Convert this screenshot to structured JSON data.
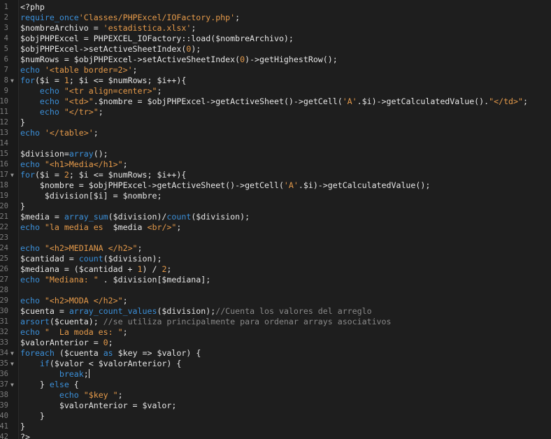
{
  "editor": {
    "lines": [
      {
        "num": "1",
        "fold": "",
        "tokens": [
          {
            "t": "def",
            "v": "<?php"
          }
        ]
      },
      {
        "num": "2",
        "fold": "",
        "tokens": [
          {
            "t": "kw",
            "v": "require_once"
          },
          {
            "t": "str",
            "v": "'Classes/PHPExcel/IOFactory.php'"
          },
          {
            "t": "def",
            "v": ";"
          }
        ]
      },
      {
        "num": "3",
        "fold": "",
        "tokens": [
          {
            "t": "var",
            "v": "$nombreArchivo = "
          },
          {
            "t": "str",
            "v": "'estadistica.xlsx'"
          },
          {
            "t": "def",
            "v": ";"
          }
        ]
      },
      {
        "num": "4",
        "fold": "",
        "tokens": [
          {
            "t": "var",
            "v": "$objPHPExcel = PHPEXCEL_IOFactory::load($nombreArchivo);"
          }
        ]
      },
      {
        "num": "5",
        "fold": "",
        "tokens": [
          {
            "t": "var",
            "v": "$objPHPExcel->setActiveSheetIndex("
          },
          {
            "t": "num",
            "v": "0"
          },
          {
            "t": "def",
            "v": ");"
          }
        ]
      },
      {
        "num": "6",
        "fold": "",
        "tokens": [
          {
            "t": "var",
            "v": "$numRows = $objPHPExcel->setActiveSheetIndex("
          },
          {
            "t": "num",
            "v": "0"
          },
          {
            "t": "def",
            "v": ")->getHighestRow();"
          }
        ]
      },
      {
        "num": "7",
        "fold": "",
        "tokens": [
          {
            "t": "kw",
            "v": "echo "
          },
          {
            "t": "str",
            "v": "'<table border=2>'"
          },
          {
            "t": "def",
            "v": ";"
          }
        ]
      },
      {
        "num": "8",
        "fold": "▼",
        "tokens": [
          {
            "t": "kw",
            "v": "for"
          },
          {
            "t": "def",
            "v": "($i = "
          },
          {
            "t": "num",
            "v": "1"
          },
          {
            "t": "def",
            "v": "; $i <= $numRows; $i++){"
          }
        ]
      },
      {
        "num": "9",
        "fold": "",
        "tokens": [
          {
            "t": "def",
            "v": "    "
          },
          {
            "t": "kw",
            "v": "echo "
          },
          {
            "t": "str",
            "v": "\"<tr align=center>\""
          },
          {
            "t": "def",
            "v": ";"
          }
        ]
      },
      {
        "num": "10",
        "fold": "",
        "tokens": [
          {
            "t": "def",
            "v": "    "
          },
          {
            "t": "kw",
            "v": "echo "
          },
          {
            "t": "str",
            "v": "\"<td>\""
          },
          {
            "t": "def",
            "v": ".$nombre = $objPHPExcel->getActiveSheet()->getCell("
          },
          {
            "t": "str",
            "v": "'A'"
          },
          {
            "t": "def",
            "v": ".$i)->getCalculatedValue()."
          },
          {
            "t": "str",
            "v": "\"</td>\""
          },
          {
            "t": "def",
            "v": ";"
          }
        ]
      },
      {
        "num": "11",
        "fold": "",
        "tokens": [
          {
            "t": "def",
            "v": "    "
          },
          {
            "t": "kw",
            "v": "echo "
          },
          {
            "t": "str",
            "v": "\"</tr>\""
          },
          {
            "t": "def",
            "v": ";"
          }
        ]
      },
      {
        "num": "12",
        "fold": "",
        "tokens": [
          {
            "t": "def",
            "v": "}"
          }
        ]
      },
      {
        "num": "13",
        "fold": "",
        "tokens": [
          {
            "t": "kw",
            "v": "echo "
          },
          {
            "t": "str",
            "v": "'</table>'"
          },
          {
            "t": "def",
            "v": ";"
          }
        ]
      },
      {
        "num": "14",
        "fold": "",
        "tokens": []
      },
      {
        "num": "15",
        "fold": "",
        "tokens": [
          {
            "t": "var",
            "v": "$division="
          },
          {
            "t": "fn",
            "v": "array"
          },
          {
            "t": "def",
            "v": "();"
          }
        ]
      },
      {
        "num": "16",
        "fold": "",
        "tokens": [
          {
            "t": "kw",
            "v": "echo "
          },
          {
            "t": "str",
            "v": "\"<h1>Media</h1>\""
          },
          {
            "t": "def",
            "v": ";"
          }
        ]
      },
      {
        "num": "17",
        "fold": "▼",
        "tokens": [
          {
            "t": "kw",
            "v": "for"
          },
          {
            "t": "def",
            "v": "($i = "
          },
          {
            "t": "num",
            "v": "2"
          },
          {
            "t": "def",
            "v": "; $i <= $numRows; $i++){"
          }
        ]
      },
      {
        "num": "18",
        "fold": "",
        "tokens": [
          {
            "t": "def",
            "v": "    $nombre = $objPHPExcel->getActiveSheet()->getCell("
          },
          {
            "t": "str",
            "v": "'A'"
          },
          {
            "t": "def",
            "v": ".$i)->getCalculatedValue();"
          }
        ]
      },
      {
        "num": "19",
        "fold": "",
        "tokens": [
          {
            "t": "def",
            "v": "     $division[$i] = $nombre;"
          }
        ]
      },
      {
        "num": "20",
        "fold": "",
        "tokens": [
          {
            "t": "def",
            "v": "}"
          }
        ]
      },
      {
        "num": "21",
        "fold": "",
        "tokens": [
          {
            "t": "var",
            "v": "$media = "
          },
          {
            "t": "fn",
            "v": "array_sum"
          },
          {
            "t": "def",
            "v": "($division)/"
          },
          {
            "t": "fn",
            "v": "count"
          },
          {
            "t": "def",
            "v": "($division);"
          }
        ]
      },
      {
        "num": "22",
        "fold": "",
        "tokens": [
          {
            "t": "kw",
            "v": "echo "
          },
          {
            "t": "str",
            "v": "\"la media es  "
          },
          {
            "t": "var",
            "v": "$media"
          },
          {
            "t": "str",
            "v": " <br/>\""
          },
          {
            "t": "def",
            "v": ";"
          }
        ]
      },
      {
        "num": "23",
        "fold": "",
        "tokens": []
      },
      {
        "num": "24",
        "fold": "",
        "tokens": [
          {
            "t": "kw",
            "v": "echo "
          },
          {
            "t": "str",
            "v": "\"<h2>MEDIANA </h2>\""
          },
          {
            "t": "def",
            "v": ";"
          }
        ]
      },
      {
        "num": "25",
        "fold": "",
        "tokens": [
          {
            "t": "var",
            "v": "$cantidad = "
          },
          {
            "t": "fn",
            "v": "count"
          },
          {
            "t": "def",
            "v": "($division);"
          }
        ]
      },
      {
        "num": "26",
        "fold": "",
        "tokens": [
          {
            "t": "var",
            "v": "$mediana = ($cantidad + "
          },
          {
            "t": "num",
            "v": "1"
          },
          {
            "t": "def",
            "v": ") / "
          },
          {
            "t": "num",
            "v": "2"
          },
          {
            "t": "def",
            "v": ";"
          }
        ]
      },
      {
        "num": "27",
        "fold": "",
        "tokens": [
          {
            "t": "kw",
            "v": "echo "
          },
          {
            "t": "str",
            "v": "\"Mediana: \""
          },
          {
            "t": "def",
            "v": " . $division[$mediana];"
          }
        ]
      },
      {
        "num": "28",
        "fold": "",
        "tokens": []
      },
      {
        "num": "29",
        "fold": "",
        "tokens": [
          {
            "t": "kw",
            "v": "echo "
          },
          {
            "t": "str",
            "v": "\"<h2>MODA </h2>\""
          },
          {
            "t": "def",
            "v": ";"
          }
        ]
      },
      {
        "num": "30",
        "fold": "",
        "tokens": [
          {
            "t": "var",
            "v": "$cuenta = "
          },
          {
            "t": "fn",
            "v": "array_count_values"
          },
          {
            "t": "def",
            "v": "($division);"
          },
          {
            "t": "cmt",
            "v": "//Cuenta los valores del arreglo"
          }
        ]
      },
      {
        "num": "31",
        "fold": "",
        "tokens": [
          {
            "t": "fn",
            "v": "arsort"
          },
          {
            "t": "def",
            "v": "($cuenta); "
          },
          {
            "t": "cmt",
            "v": "//se utiliza principalmente para ordenar arrays asociativos"
          }
        ]
      },
      {
        "num": "32",
        "fold": "",
        "tokens": [
          {
            "t": "kw",
            "v": "echo "
          },
          {
            "t": "str",
            "v": "\"  La moda es: \""
          },
          {
            "t": "def",
            "v": ";"
          }
        ]
      },
      {
        "num": "33",
        "fold": "",
        "tokens": [
          {
            "t": "var",
            "v": "$valorAnterior = "
          },
          {
            "t": "num",
            "v": "0"
          },
          {
            "t": "def",
            "v": ";"
          }
        ]
      },
      {
        "num": "34",
        "fold": "▼",
        "tokens": [
          {
            "t": "kw",
            "v": "foreach"
          },
          {
            "t": "def",
            "v": " ($cuenta "
          },
          {
            "t": "kw",
            "v": "as"
          },
          {
            "t": "def",
            "v": " $key => $valor) {"
          }
        ]
      },
      {
        "num": "35",
        "fold": "▼",
        "tokens": [
          {
            "t": "def",
            "v": "    "
          },
          {
            "t": "kw",
            "v": "if"
          },
          {
            "t": "def",
            "v": "($valor < $valorAnterior) {"
          }
        ]
      },
      {
        "num": "36",
        "fold": "",
        "tokens": [
          {
            "t": "def",
            "v": "        "
          },
          {
            "t": "kw",
            "v": "break"
          },
          {
            "t": "def",
            "v": ";"
          },
          {
            "t": "cursor",
            "v": ""
          }
        ]
      },
      {
        "num": "37",
        "fold": "▼",
        "tokens": [
          {
            "t": "def",
            "v": "    } "
          },
          {
            "t": "kw",
            "v": "else"
          },
          {
            "t": "def",
            "v": " {"
          }
        ]
      },
      {
        "num": "38",
        "fold": "",
        "tokens": [
          {
            "t": "def",
            "v": "        "
          },
          {
            "t": "kw",
            "v": "echo "
          },
          {
            "t": "str",
            "v": "\"$key \""
          },
          {
            "t": "def",
            "v": ";"
          }
        ]
      },
      {
        "num": "39",
        "fold": "",
        "tokens": [
          {
            "t": "def",
            "v": "        $valorAnterior = $valor;"
          }
        ]
      },
      {
        "num": "40",
        "fold": "",
        "tokens": [
          {
            "t": "def",
            "v": "    }"
          }
        ]
      },
      {
        "num": "41",
        "fold": "",
        "tokens": [
          {
            "t": "def",
            "v": "}"
          }
        ]
      },
      {
        "num": "42",
        "fold": "",
        "tokens": [
          {
            "t": "def",
            "v": "?>"
          }
        ]
      }
    ]
  }
}
